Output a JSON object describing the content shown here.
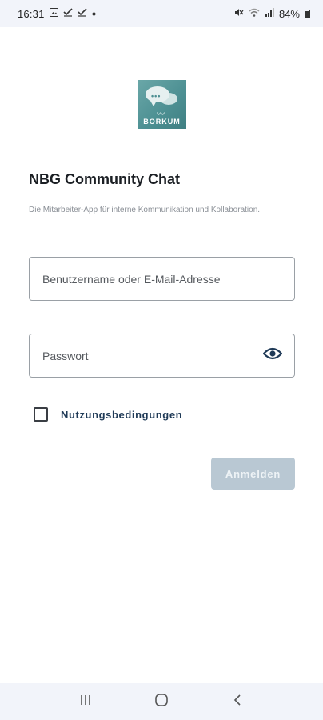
{
  "status_bar": {
    "time": "16:31",
    "battery": "84%",
    "notification_icons": [
      "image-icon",
      "check-icon",
      "check-icon",
      "dot-icon"
    ],
    "system_icons": [
      "mute-icon",
      "wifi-icon",
      "signal-icon",
      "battery-icon"
    ]
  },
  "logo": {
    "brand_text": "BORKUM"
  },
  "app": {
    "title": "NBG Community Chat",
    "subtitle": "Die Mitarbeiter-App für interne Kommunikation und Kollaboration."
  },
  "form": {
    "username_placeholder": "Benutzername oder E-Mail-Adresse",
    "username_value": "",
    "password_placeholder": "Passwort",
    "password_value": "",
    "terms_label": "Nutzungsbedingungen",
    "terms_checked": false,
    "login_label": "Anmelden"
  },
  "colors": {
    "accent": "#1f3a57",
    "button_disabled": "#b9c8d3",
    "logo_teal": "#4c8f92"
  }
}
